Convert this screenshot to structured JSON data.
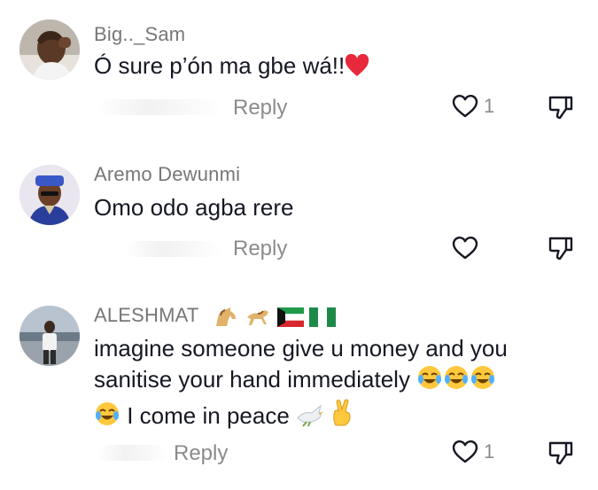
{
  "colors": {
    "text": "#161823",
    "username": "#767778",
    "meta": "#8a8b8c",
    "heart_red": "#e8293b",
    "emoji_yellow": "#ffc83d"
  },
  "comments": [
    {
      "username": "Big.._Sam",
      "text": "Ó sure p’ón ma gbe wá!!",
      "trailing_emoji": "red-heart",
      "reply_label": "Reply",
      "like_count": "1"
    },
    {
      "username": "Aremo Dewunmi",
      "text": "Omo odo agba rere",
      "reply_label": "Reply",
      "like_count": ""
    },
    {
      "username": "ALESHMAT",
      "username_badges": [
        "horse-emoji",
        "horse-emoji",
        "kuwait-flag",
        "nigeria-flag"
      ],
      "text_line1": "imagine someone give u money and you",
      "text_line2": "sanitise your hand immediately",
      "text_line3": "I come in peace",
      "reply_label": "Reply",
      "like_count": "1"
    }
  ]
}
